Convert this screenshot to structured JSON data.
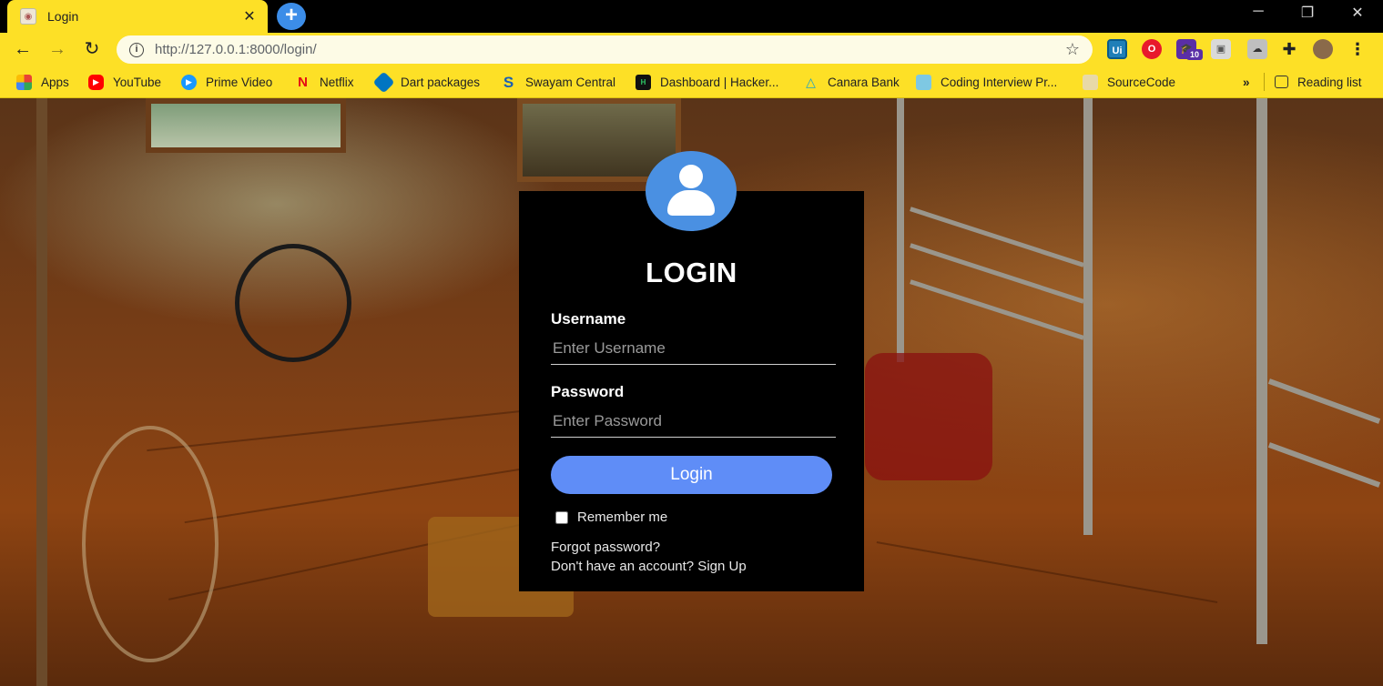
{
  "browser": {
    "tab_title": "Login",
    "tab_close": "✕",
    "new_tab": "+",
    "window_controls": {
      "minimize": "─",
      "restore": "❐",
      "close": "✕"
    },
    "url": "http://127.0.0.1:8000/login/",
    "theme_color": "#fde026",
    "extensions": [
      "ui-extension-icon",
      "opera-icon",
      "graduation-icon",
      "window-icon",
      "cloud-icon",
      "puzzle-icon",
      "avatar-icon",
      "menu-icon"
    ],
    "extension_badge": "10"
  },
  "bookmarks": [
    {
      "label": "Apps",
      "icon": "apps-icon"
    },
    {
      "label": "YouTube",
      "icon": "youtube-icon"
    },
    {
      "label": "Prime Video",
      "icon": "prime-video-icon"
    },
    {
      "label": "Netflix",
      "icon": "netflix-icon"
    },
    {
      "label": "Dart packages",
      "icon": "dart-icon"
    },
    {
      "label": "Swayam Central",
      "icon": "swayam-icon"
    },
    {
      "label": "Dashboard | Hacker...",
      "icon": "hackerrank-icon"
    },
    {
      "label": "Canara Bank",
      "icon": "canara-icon"
    },
    {
      "label": "Coding Interview Pr...",
      "icon": "book-icon"
    },
    {
      "label": "SourceCode",
      "icon": "sourcecode-icon"
    }
  ],
  "bookmarks_overflow": "»",
  "reading_list": "Reading list",
  "login": {
    "title": "LOGIN",
    "username_label": "Username",
    "username_placeholder": "Enter Username",
    "password_label": "Password",
    "password_placeholder": "Enter Password",
    "button": "Login",
    "remember": "Remember me",
    "forgot": "Forgot password?",
    "signup": "Don't have an account? Sign Up",
    "button_color": "#5f8df7",
    "avatar_color": "#4a90e2"
  }
}
